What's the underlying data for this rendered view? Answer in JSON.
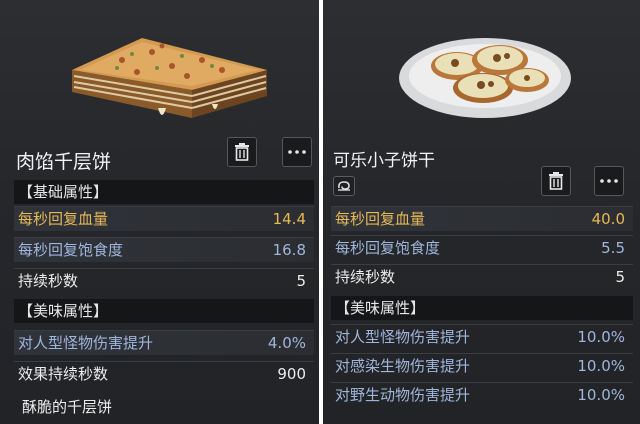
{
  "left": {
    "name": "肉馅千层饼",
    "base_header": "【基础属性】",
    "base_stats": [
      {
        "label": "每秒回复血量",
        "value": "14.4",
        "color": "#e7b954"
      },
      {
        "label": "每秒回复饱食度",
        "value": "16.8",
        "color": "#9fb6dc"
      },
      {
        "label": "持续秒数",
        "value": "5",
        "color": "#ececec"
      }
    ],
    "flavor_header": "【美味属性】",
    "flavor_stats": [
      {
        "label": "对人型怪物伤害提升",
        "value": "4.0%",
        "color": "#9fb6dc"
      },
      {
        "label": "效果持续秒数",
        "value": "900",
        "color": "#ececec"
      }
    ],
    "flavor_text": "酥脆的千层饼",
    "delete_icon": "trash-icon",
    "more_icon": "more-dots-icon"
  },
  "right": {
    "name": "可乐小子饼干",
    "badge_icon": "swirl-badge-icon",
    "base_stats": [
      {
        "label": "每秒回复血量",
        "value": "40.0",
        "color": "#e7b954"
      },
      {
        "label": "每秒回复饱食度",
        "value": "5.5",
        "color": "#9fb6dc"
      },
      {
        "label": "持续秒数",
        "value": "5",
        "color": "#ececec"
      }
    ],
    "flavor_header": "【美味属性】",
    "flavor_stats": [
      {
        "label": "对人型怪物伤害提升",
        "value": "10.0%",
        "color": "#9fb6dc"
      },
      {
        "label": "对感染生物伤害提升",
        "value": "10.0%",
        "color": "#9fb6dc"
      },
      {
        "label": "对野生动物伤害提升",
        "value": "10.0%",
        "color": "#9fb6dc"
      }
    ],
    "delete_icon": "trash-icon",
    "more_icon": "more-dots-icon"
  }
}
